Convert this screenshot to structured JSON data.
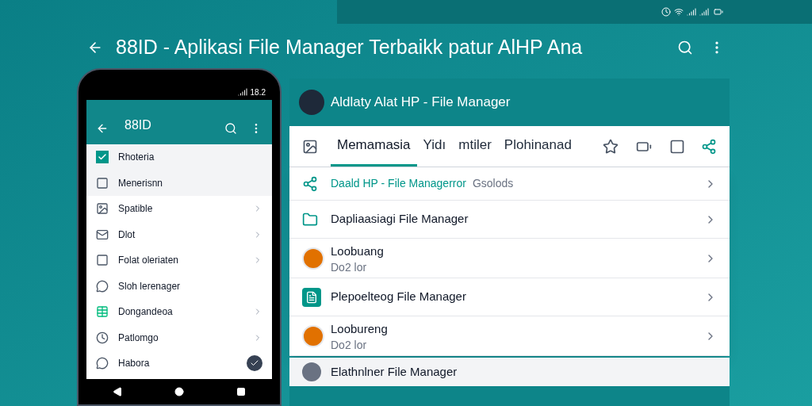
{
  "toolbar": {
    "title": "88ID - Aplikasi File Manager Terbaikk patur AlHP Ana"
  },
  "phone": {
    "clock": "18.2",
    "app_bar": {
      "title": "88ID"
    },
    "items": [
      {
        "label": "Rhoteria",
        "kind": "checkbox",
        "selected": true,
        "chevron": false
      },
      {
        "label": "Menerisnn",
        "kind": "box",
        "selected": true,
        "chevron": false
      },
      {
        "label": "Spatible",
        "kind": "image",
        "selected": false,
        "chevron": true
      },
      {
        "label": "Dlot",
        "kind": "mail",
        "selected": false,
        "chevron": true
      },
      {
        "label": "Folat oleriaten",
        "kind": "box",
        "selected": false,
        "chevron": true
      },
      {
        "label": "Sloh lerenager",
        "kind": "bubble",
        "selected": false,
        "chevron": false
      },
      {
        "label": "Dongandeoa",
        "kind": "sheet",
        "selected": false,
        "chevron": true
      },
      {
        "label": "Patlomgo",
        "kind": "clock",
        "selected": false,
        "chevron": true
      },
      {
        "label": "Habora",
        "kind": "chat",
        "selected": false,
        "chevron": false,
        "badge": true
      }
    ]
  },
  "panel": {
    "title": "Aldlaty Alat HP - File Manager",
    "tabs": [
      {
        "label": "Memamasia",
        "selected": true
      },
      {
        "label": "Yidı",
        "selected": false
      },
      {
        "label": "mtiler",
        "selected": false
      },
      {
        "label": "Plohinanad",
        "selected": false
      }
    ],
    "rows": [
      {
        "kind": "link",
        "title": "Daald HP - File Managerror",
        "suffix": "Gsolods"
      },
      {
        "kind": "folder",
        "title": "Dapliaasiagi File Manager"
      },
      {
        "kind": "avatar",
        "title": "Loobuang",
        "subtitle": "Do2 lor"
      },
      {
        "kind": "document",
        "title": "Plepoelteog  File Manager"
      },
      {
        "kind": "avatar",
        "title": "Loobureng",
        "subtitle": "Do2 lor"
      }
    ],
    "below_row": {
      "title": "Elathnlner File Manager"
    }
  }
}
